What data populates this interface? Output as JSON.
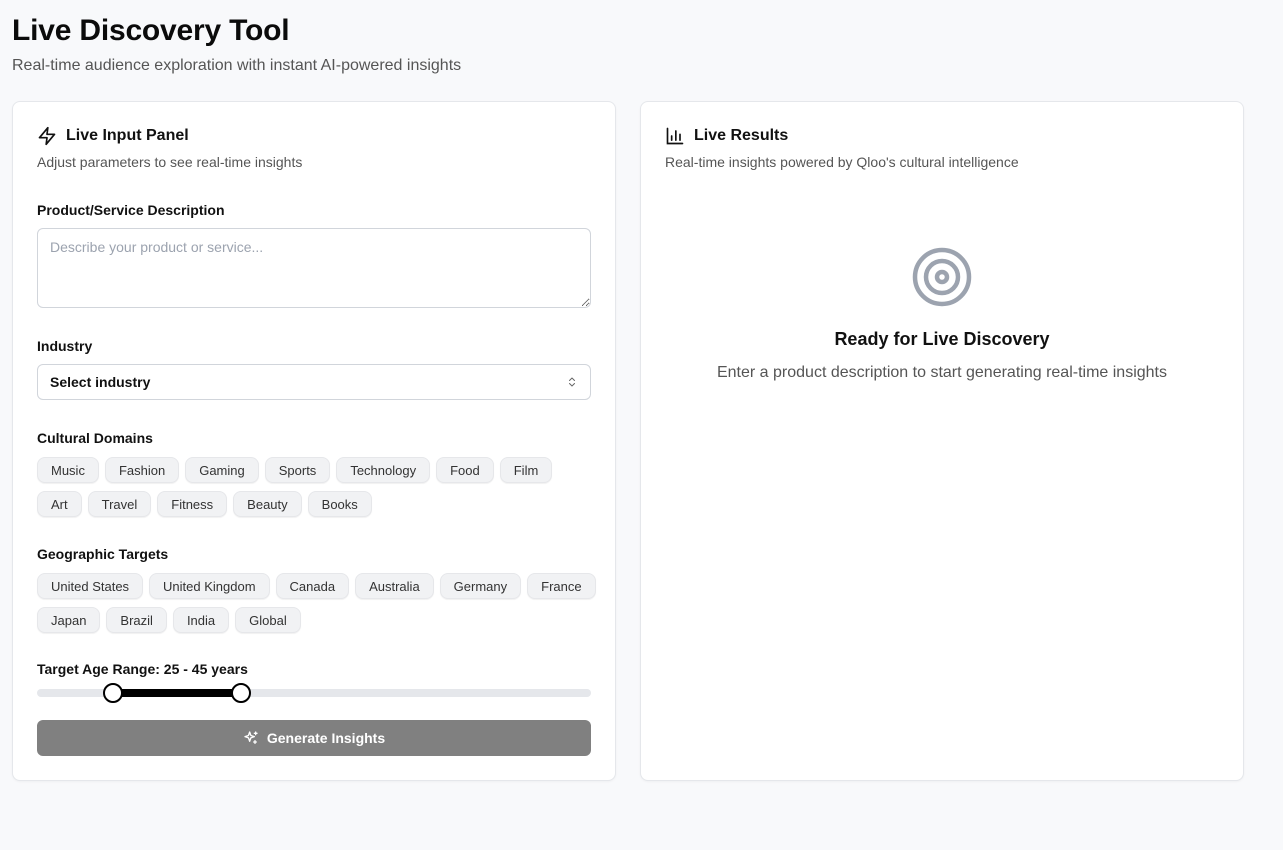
{
  "header": {
    "title": "Live Discovery Tool",
    "subtitle": "Real-time audience exploration with instant AI-powered insights"
  },
  "input_panel": {
    "title": "Live Input Panel",
    "description": "Adjust parameters to see real-time insights",
    "icon": "zap-icon",
    "product": {
      "label": "Product/Service Description",
      "placeholder": "Describe your product or service...",
      "value": ""
    },
    "industry": {
      "label": "Industry",
      "selected": "Select industry",
      "icon": "chevrons-up-down-icon"
    },
    "cultural_domains": {
      "label": "Cultural Domains",
      "options": [
        "Music",
        "Fashion",
        "Gaming",
        "Sports",
        "Technology",
        "Food",
        "Film",
        "Art",
        "Travel",
        "Fitness",
        "Beauty",
        "Books"
      ]
    },
    "geographic_targets": {
      "label": "Geographic Targets",
      "options": [
        "United States",
        "United Kingdom",
        "Canada",
        "Australia",
        "Germany",
        "France",
        "Japan",
        "Brazil",
        "India",
        "Global"
      ]
    },
    "age_range": {
      "label": "Target Age Range: 25 - 45 years",
      "min": 13,
      "max": 100,
      "low": 25,
      "high": 45
    },
    "generate_button": {
      "label": "Generate Insights",
      "icon": "sparkles-icon",
      "background": "#808080"
    }
  },
  "results_panel": {
    "title": "Live Results",
    "description": "Real-time insights powered by Qloo's cultural intelligence",
    "icon": "bar-chart-icon",
    "empty_state": {
      "icon": "target-icon",
      "title": "Ready for Live Discovery",
      "description": "Enter a product description to start generating real-time insights"
    }
  }
}
